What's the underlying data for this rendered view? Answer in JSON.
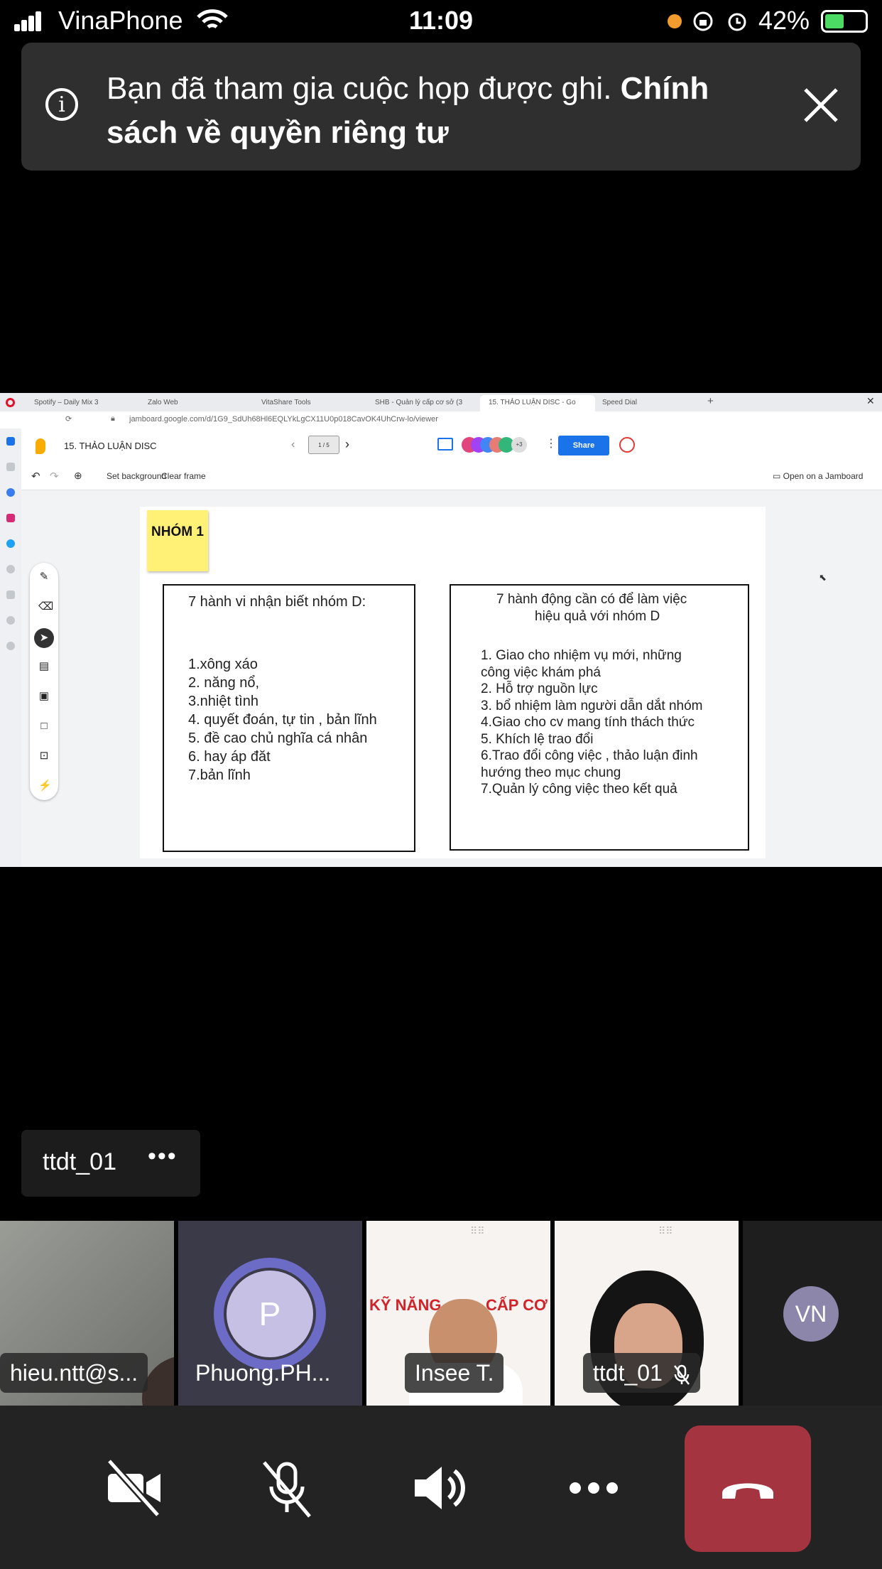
{
  "status_bar": {
    "carrier": "VinaPhone",
    "time": "11:09",
    "battery": "42%"
  },
  "banner": {
    "text": "Bạn đã tham gia cuộc họp được ghi. ",
    "link": "Chính sách về quyền riêng tư"
  },
  "browser": {
    "tabs": [
      "Spotify – Daily Mix 3",
      "Zalo Web",
      "VitaShare Tools",
      "SHB - Quản lý cấp cơ sở (3",
      "15. THẢO LUẬN DISC - Go",
      "Speed Dial"
    ],
    "url": "jamboard.google.com/d/1G9_SdUh68Hl6EQLYkLgCX11U0p018CavOK4UhCrw-lo/viewer"
  },
  "jamboard": {
    "title": "15. THẢO LUẬN DISC",
    "frame_counter": "1 / 5",
    "extra_collaborators": "+3",
    "share_label": "Share",
    "set_background": "Set background",
    "clear_frame": "Clear frame",
    "open_label": "Open on a Jamboard",
    "sticky": "NHÓM 1",
    "box1": {
      "title": "7 hành vi nhận biết nhóm D:",
      "items": [
        "1.xông xáo",
        "2. năng nổ,",
        "3.nhiệt tình",
        "4. quyết đoán, tự tin , bản lĩnh",
        "5. đề cao chủ nghĩa cá nhân",
        "6. hay áp đăt",
        "7.bản lĩnh"
      ]
    },
    "box2": {
      "title_line1": "7 hành động cần có để làm việc",
      "title_line2": "hiệu quả với nhóm D",
      "items": [
        "1. Giao cho nhiệm vụ mới, những",
        "công việc khám phá",
        "2. Hỗ trợ nguồn lực",
        "3. bổ nhiệm làm người dẫn dắt nhóm",
        "4.Giao cho cv mang tính thách thức",
        "5. Khích lệ trao đổi",
        "6.Trao đổi công việc , thảo luận đinh",
        "hướng theo mục chung",
        "7.Quản lý công việc theo kết quả"
      ]
    }
  },
  "presenter": {
    "name": "ttdt_01"
  },
  "participants": [
    {
      "name": "hieu.ntt@s..."
    },
    {
      "name": "Phuong.PH...",
      "initial": "P"
    },
    {
      "name": "Insee T."
    },
    {
      "name": "ttdt_01"
    },
    {
      "initials": "VN"
    }
  ],
  "banner_image_text": {
    "title": "KỸ NĂNG",
    "sub": "CẤP CƠ SỞ"
  },
  "colors": {
    "end_call": "#a4343f",
    "share_button": "#1a73e8",
    "sticky": "#fff176",
    "avatar_ring": "#6c6cc6"
  }
}
